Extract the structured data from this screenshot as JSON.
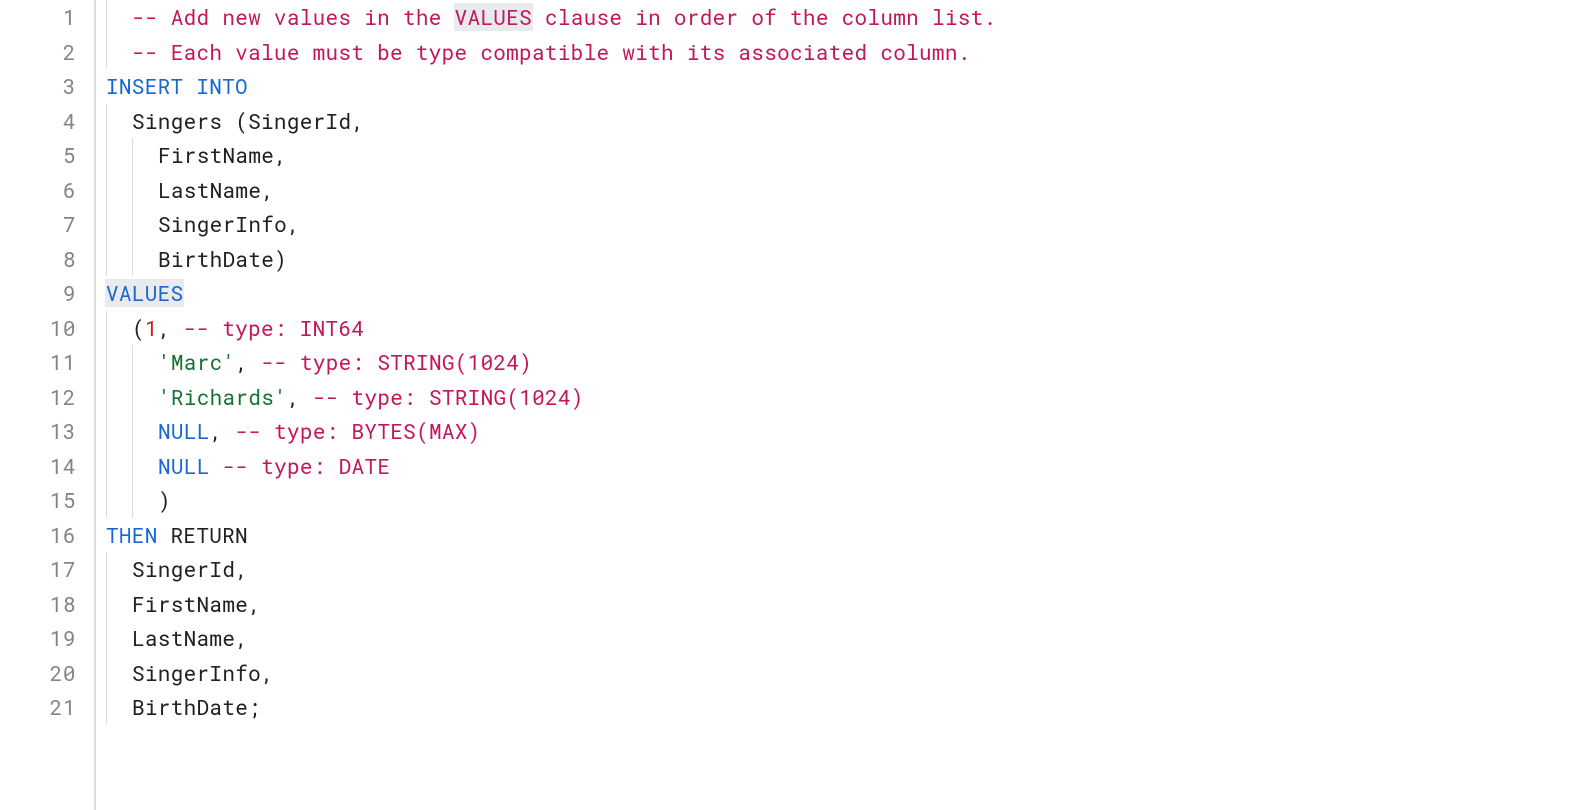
{
  "lineCount": 21,
  "lines": [
    {
      "indent": 1,
      "guides": [
        0
      ],
      "tokens": [
        {
          "cls": "tok-comment",
          "text": "-- Add new values in the "
        },
        {
          "cls": "tok-comment hl",
          "text": "VALUES"
        },
        {
          "cls": "tok-comment",
          "text": " clause in order of the column list."
        }
      ]
    },
    {
      "indent": 1,
      "guides": [
        0
      ],
      "tokens": [
        {
          "cls": "tok-comment",
          "text": "-- Each value must be type compatible with its associated column."
        }
      ]
    },
    {
      "indent": 0,
      "guides": [],
      "tokens": [
        {
          "cls": "tok-keyword",
          "text": "INSERT INTO"
        }
      ]
    },
    {
      "indent": 1,
      "guides": [
        0
      ],
      "tokens": [
        {
          "cls": "tok-plain",
          "text": "Singers "
        },
        {
          "cls": "tok-paren",
          "text": "("
        },
        {
          "cls": "tok-plain",
          "text": "SingerId"
        },
        {
          "cls": "tok-punct",
          "text": ","
        }
      ]
    },
    {
      "indent": 2,
      "guides": [
        0,
        1
      ],
      "tokens": [
        {
          "cls": "tok-plain",
          "text": "FirstName"
        },
        {
          "cls": "tok-punct",
          "text": ","
        }
      ]
    },
    {
      "indent": 2,
      "guides": [
        0,
        1
      ],
      "tokens": [
        {
          "cls": "tok-plain",
          "text": "LastName"
        },
        {
          "cls": "tok-punct",
          "text": ","
        }
      ]
    },
    {
      "indent": 2,
      "guides": [
        0,
        1
      ],
      "tokens": [
        {
          "cls": "tok-plain",
          "text": "SingerInfo"
        },
        {
          "cls": "tok-punct",
          "text": ","
        }
      ]
    },
    {
      "indent": 2,
      "guides": [
        0,
        1
      ],
      "tokens": [
        {
          "cls": "tok-plain",
          "text": "BirthDate"
        },
        {
          "cls": "tok-paren",
          "text": ")"
        }
      ]
    },
    {
      "indent": 0,
      "guides": [],
      "tokens": [
        {
          "cls": "tok-keyword hl",
          "text": "VALUES"
        }
      ]
    },
    {
      "indent": 1,
      "guides": [
        0
      ],
      "tokens": [
        {
          "cls": "tok-paren",
          "text": "("
        },
        {
          "cls": "tok-number",
          "text": "1"
        },
        {
          "cls": "tok-punct",
          "text": ", "
        },
        {
          "cls": "tok-comment",
          "text": "-- type: INT64"
        }
      ]
    },
    {
      "indent": 2,
      "guides": [
        0,
        1
      ],
      "tokens": [
        {
          "cls": "tok-string",
          "text": "'Marc'"
        },
        {
          "cls": "tok-punct",
          "text": ", "
        },
        {
          "cls": "tok-comment",
          "text": "-- type: STRING(1024)"
        }
      ]
    },
    {
      "indent": 2,
      "guides": [
        0,
        1
      ],
      "tokens": [
        {
          "cls": "tok-string",
          "text": "'Richards'"
        },
        {
          "cls": "tok-punct",
          "text": ", "
        },
        {
          "cls": "tok-comment",
          "text": "-- type: STRING(1024)"
        }
      ]
    },
    {
      "indent": 2,
      "guides": [
        0,
        1
      ],
      "tokens": [
        {
          "cls": "tok-null",
          "text": "NULL"
        },
        {
          "cls": "tok-punct",
          "text": ", "
        },
        {
          "cls": "tok-comment",
          "text": "-- type: BYTES(MAX)"
        }
      ]
    },
    {
      "indent": 2,
      "guides": [
        0,
        1
      ],
      "tokens": [
        {
          "cls": "tok-null",
          "text": "NULL"
        },
        {
          "cls": "tok-plain",
          "text": " "
        },
        {
          "cls": "tok-comment",
          "text": "-- type: DATE"
        }
      ]
    },
    {
      "indent": 2,
      "guides": [
        0,
        1
      ],
      "tokens": [
        {
          "cls": "tok-paren",
          "text": ")"
        }
      ]
    },
    {
      "indent": 0,
      "guides": [],
      "tokens": [
        {
          "cls": "tok-keyword",
          "text": "THEN"
        },
        {
          "cls": "tok-plain",
          "text": " RETURN"
        }
      ]
    },
    {
      "indent": 1,
      "guides": [
        0
      ],
      "tokens": [
        {
          "cls": "tok-plain",
          "text": "SingerId"
        },
        {
          "cls": "tok-punct",
          "text": ","
        }
      ]
    },
    {
      "indent": 1,
      "guides": [
        0
      ],
      "tokens": [
        {
          "cls": "tok-plain",
          "text": "FirstName"
        },
        {
          "cls": "tok-punct",
          "text": ","
        }
      ]
    },
    {
      "indent": 1,
      "guides": [
        0
      ],
      "tokens": [
        {
          "cls": "tok-plain",
          "text": "LastName"
        },
        {
          "cls": "tok-punct",
          "text": ","
        }
      ]
    },
    {
      "indent": 1,
      "guides": [
        0
      ],
      "tokens": [
        {
          "cls": "tok-plain",
          "text": "SingerInfo"
        },
        {
          "cls": "tok-punct",
          "text": ","
        }
      ]
    },
    {
      "indent": 1,
      "guides": [
        0
      ],
      "tokens": [
        {
          "cls": "tok-plain",
          "text": "BirthDate"
        },
        {
          "cls": "tok-punct",
          "text": ";"
        }
      ]
    }
  ]
}
